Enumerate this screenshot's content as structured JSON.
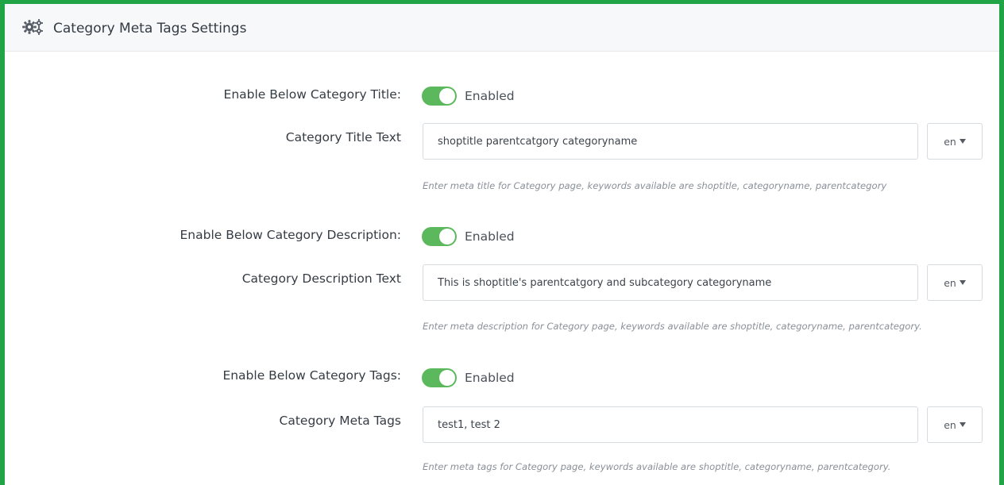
{
  "panel": {
    "title": "Category Meta Tags Settings",
    "icon": "cogs-icon"
  },
  "colors": {
    "frame_border": "#21a446",
    "toggle_on": "#5cb85c",
    "header_bg": "#f7f8fa"
  },
  "settings": {
    "title_toggle": {
      "label": "Enable Below Category Title:",
      "state_text": "Enabled",
      "on": true
    },
    "title_text": {
      "label": "Category Title Text",
      "value": "shoptitle parentcatgory categoryname",
      "lang": "en",
      "help": "Enter meta title for Category page, keywords available are shoptitle, categoryname, parentcategory"
    },
    "description_toggle": {
      "label": "Enable Below Category Description:",
      "state_text": "Enabled",
      "on": true
    },
    "description_text": {
      "label": "Category Description Text",
      "value": "This is shoptitle's parentcatgory and subcategory categoryname",
      "lang": "en",
      "help": "Enter meta description for Category page, keywords available are shoptitle, categoryname, parentcategory."
    },
    "tags_toggle": {
      "label": "Enable Below Category Tags:",
      "state_text": "Enabled",
      "on": true
    },
    "tags_text": {
      "label": "Category Meta Tags",
      "value": "test1, test 2",
      "lang": "en",
      "help": "Enter meta tags for Category page, keywords available are shoptitle, categoryname, parentcategory."
    }
  }
}
